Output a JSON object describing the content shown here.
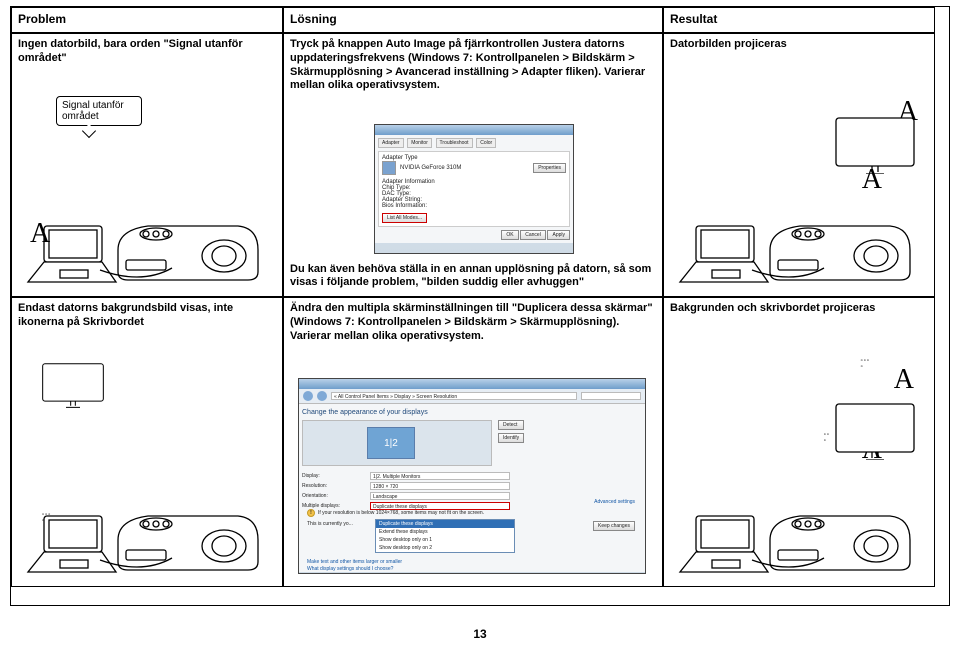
{
  "headers": {
    "problem": "Problem",
    "losning": "Lösning",
    "resultat": "Resultat"
  },
  "row1": {
    "problem": "Ingen datorbild, bara orden \"Signal utanför området\"",
    "callout": "Signal utanför området",
    "losning": "Tryck på knappen Auto Image på fjärrkontrollen Justera datorns uppdateringsfrekvens (Windows 7: Kontrollpanelen > Bildskärm > Skärmupplösning > Avancerad inställning > Adapter fliken). Varierar mellan olika operativsystem.",
    "losning2": "Du kan även behöva ställa in en annan upplösning på datorn, så som visas i följande problem, \"bilden suddig eller avhuggen\"",
    "resultat": "Datorbilden projiceras"
  },
  "row2": {
    "problem": "Endast datorns bakgrundsbild visas, inte ikonerna på Skrivbordet",
    "losning": "Ändra den multipla skärminställningen till \"Duplicera dessa skärmar\" (Windows 7: Kontrollpanelen > Bildskärm > Skärmupplösning). Varierar mellan olika operativsystem.",
    "resultat": "Bakgrunden och skrivbordet projiceras"
  },
  "win1": {
    "tabs": [
      "Adapter",
      "Monitor",
      "Troubleshoot",
      "Color"
    ],
    "labels": [
      "Adapter Type",
      "NVIDIA GeForce 310M",
      "Adapter Information",
      "Chip Type:",
      "DAC Type:",
      "Adapter String:",
      "Bios Information:"
    ],
    "btn1": "Properties",
    "btn2": "List All Modes...",
    "actions": [
      "OK",
      "Cancel",
      "Apply"
    ]
  },
  "win2": {
    "breadcrumb": "« All Control Panel Items » Display » Screen Resolution",
    "title": "Change the appearance of your displays",
    "detect": "Detect",
    "identify": "Identify",
    "labels": {
      "display": "Display:",
      "resolution": "Resolution:",
      "orientation": "Orientation:",
      "multi": "Multiple displays:"
    },
    "values": {
      "display": "1|2. Multiple Monitors",
      "resolution": "1280 × 720",
      "orientation": "Landscape",
      "multi": "Duplicate these displays"
    },
    "options": [
      "Duplicate these displays",
      "Extend these displays",
      "Show desktop only on 1",
      "Show desktop only on 2"
    ],
    "note": "If your resolution is below 1024×768, some items may not fit on the screen.",
    "currently": "This is currently yo...",
    "link1": "Make text and other items larger or smaller",
    "link2": "What display settings should I choose?",
    "adv": "Advanced settings",
    "keep": "Keep changes"
  },
  "page": "13",
  "A": "A"
}
